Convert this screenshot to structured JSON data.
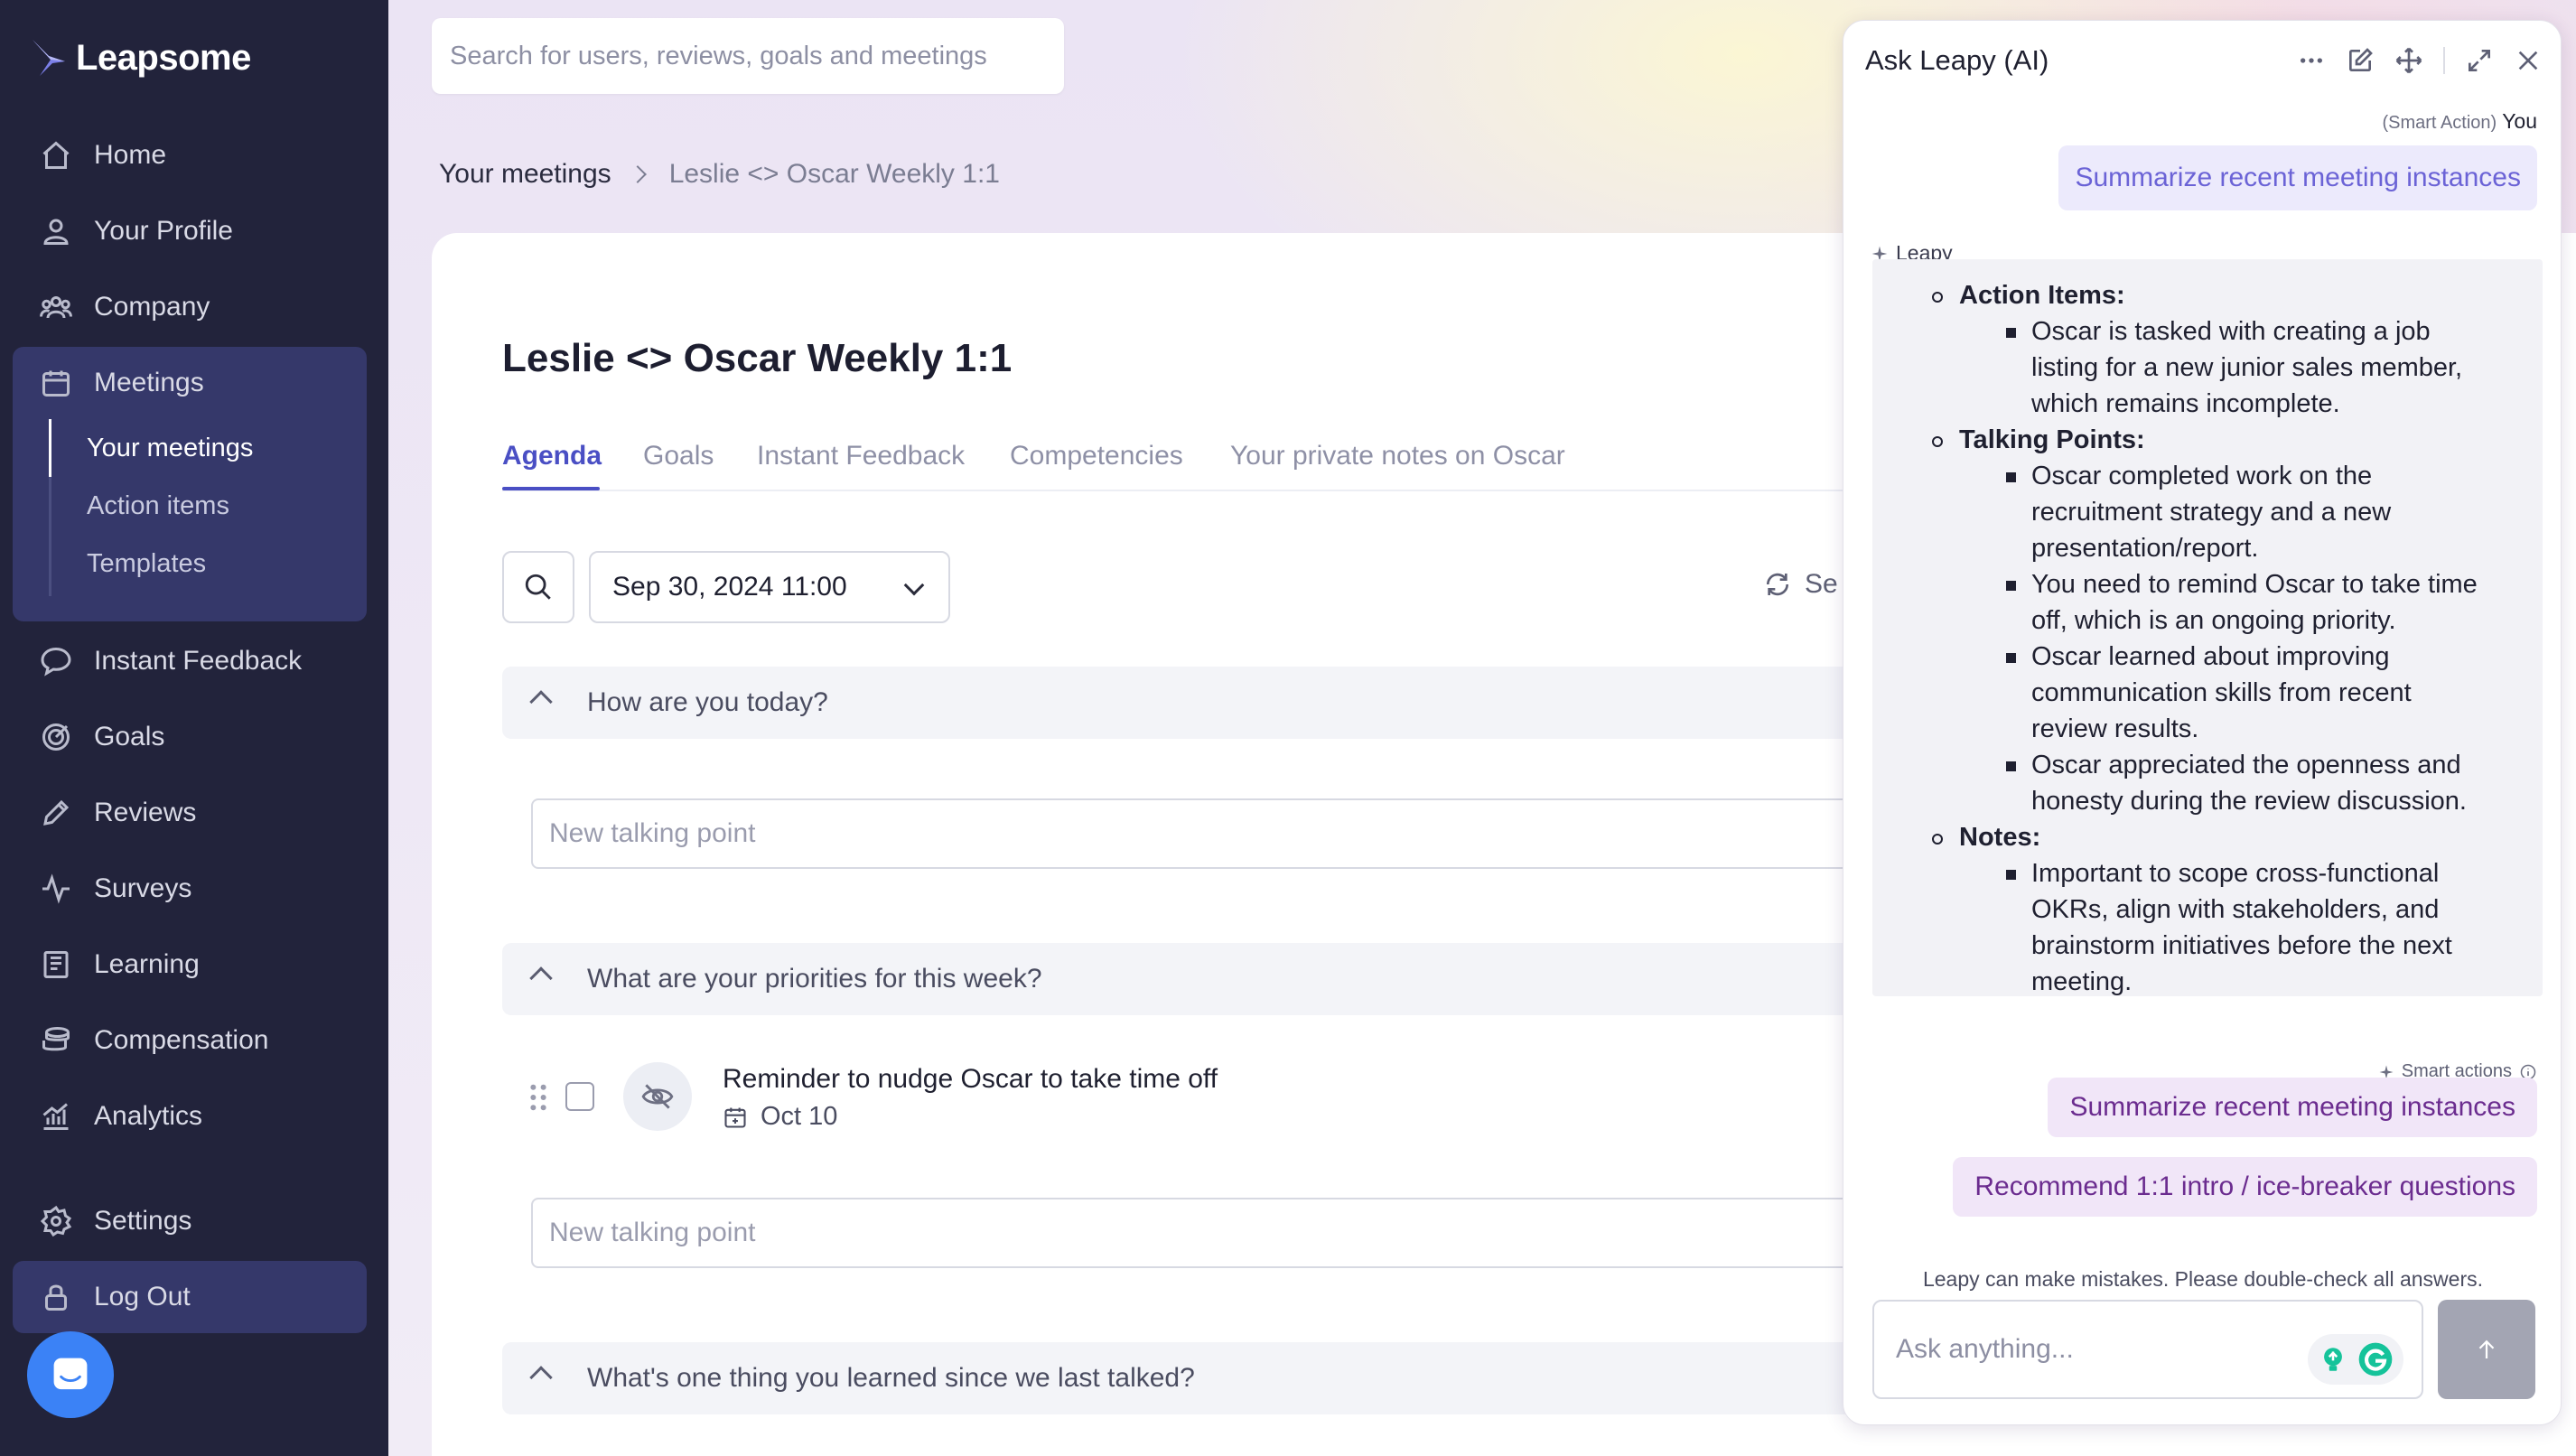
{
  "app": {
    "name": "Leapsome"
  },
  "sidebar": {
    "items": [
      {
        "label": "Home",
        "icon": "home-icon"
      },
      {
        "label": "Your Profile",
        "icon": "user-icon"
      },
      {
        "label": "Company",
        "icon": "company-icon"
      },
      {
        "label": "Meetings",
        "icon": "calendar-icon"
      },
      {
        "label": "Instant Feedback",
        "icon": "chat-icon"
      },
      {
        "label": "Goals",
        "icon": "target-icon"
      },
      {
        "label": "Reviews",
        "icon": "pencil-icon"
      },
      {
        "label": "Surveys",
        "icon": "pulse-icon"
      },
      {
        "label": "Learning",
        "icon": "book-icon"
      },
      {
        "label": "Compensation",
        "icon": "coins-icon"
      },
      {
        "label": "Analytics",
        "icon": "chart-icon"
      },
      {
        "label": "Settings",
        "icon": "gear-icon"
      },
      {
        "label": "Log Out",
        "icon": "lock-icon"
      }
    ],
    "meetings_sub": [
      "Your meetings",
      "Action items",
      "Templates"
    ],
    "active_sub": "Your meetings"
  },
  "search": {
    "placeholder": "Search for users, reviews, goals and meetings"
  },
  "breadcrumb": {
    "parent": "Your meetings",
    "current": "Leslie <> Oscar Weekly 1:1"
  },
  "meeting": {
    "title": "Leslie <> Oscar Weekly 1:1",
    "tabs": [
      "Agenda",
      "Goals",
      "Instant Feedback",
      "Competencies",
      "Your private notes on Oscar"
    ],
    "active_tab": "Agenda",
    "selected_date": "Sep 30, 2024 11:00",
    "sync_label": "Se",
    "sections": [
      "How are you today?",
      "What are your priorities for this week?",
      "What's one thing you learned since we last talked?"
    ],
    "new_talking_point_placeholder": "New talking point",
    "action_item": {
      "title": "Reminder to nudge Oscar to take time off",
      "date": "Oct 10"
    }
  },
  "ai_panel": {
    "title": "Ask Leapy (AI)",
    "smart_action_tag": "(Smart Action)",
    "user_name": "You",
    "user_message": "Summarize recent meeting instances",
    "assistant_name": "Leapy",
    "answer_lines": [
      "Action Items:",
      "Oscar is tasked with creating a job",
      "listing for a new junior sales member,",
      "which remains incomplete.",
      "Talking Points:",
      "Oscar completed work on the",
      "recruitment strategy and a new",
      "presentation/report.",
      "You need to remind Oscar to take time",
      "off, which is an ongoing priority.",
      "Oscar learned about improving",
      "communication skills from recent",
      "review results.",
      "Oscar appreciated the openness and",
      "honesty during the review discussion.",
      "Notes:",
      "Important to scope cross-functional",
      "OKRs, align with stakeholders, and",
      "brainstorm initiatives before the next",
      "meeting."
    ],
    "smart_actions_label": "Smart actions",
    "smart_actions": [
      "Summarize recent meeting instances",
      "Recommend 1:1 intro / ice-breaker questions"
    ],
    "disclaimer": "Leapy can make mistakes. Please double-check all answers.",
    "input_placeholder": "Ask anything..."
  },
  "colors": {
    "sidebar_bg": "#22233b",
    "sidebar_active": "#35386a",
    "accent": "#4a4fc4",
    "smart_action_bg": "#f1e6f8"
  }
}
